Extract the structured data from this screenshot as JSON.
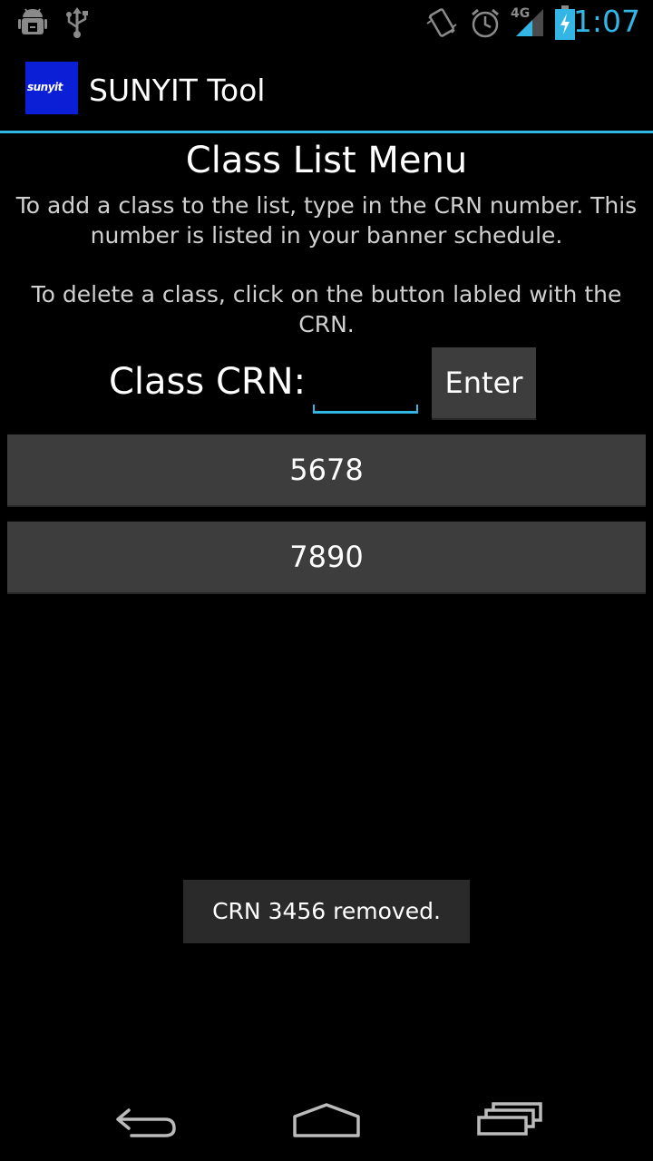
{
  "status_bar": {
    "time": "1:07",
    "network": "4G",
    "icons": [
      "android-debug-icon",
      "usb-icon",
      "vibrate-icon",
      "alarm-icon",
      "signal-icon",
      "battery-charging-icon"
    ]
  },
  "action_bar": {
    "logo_text": "sunyit",
    "title": "SUNYIT Tool"
  },
  "main": {
    "title": "Class List Menu",
    "add_instructions": "To add a class to the list, type in the CRN number. This number is listed in your banner schedule.",
    "delete_instructions": "To delete a class, click on the button labled with the CRN.",
    "crn_label": "Class CRN:",
    "crn_input_value": "",
    "enter_label": "Enter",
    "classes": [
      "5678",
      "7890"
    ]
  },
  "toast": {
    "message": "CRN 3456 removed."
  },
  "nav_bar": {
    "icons": [
      "back-icon",
      "home-icon",
      "recent-apps-icon"
    ]
  },
  "colors": {
    "accent": "#33b5e5",
    "button_bg": "#3d3d3d",
    "logo_bg": "#0a1fd6"
  }
}
